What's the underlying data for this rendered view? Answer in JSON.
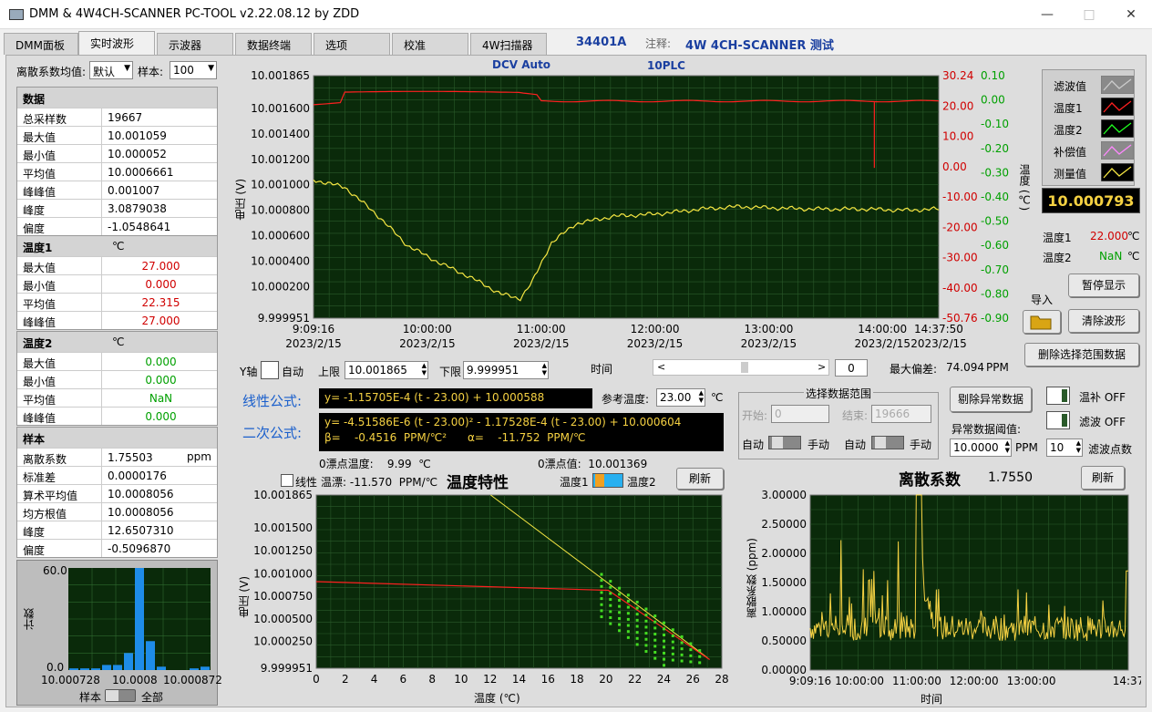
{
  "window": {
    "title": "DMM & 4W4CH-SCANNER PC-TOOL v2.22.08.12 by ZDD"
  },
  "tabs": [
    "DMM面板",
    "实时波形",
    "示波器",
    "数据终端",
    "选项",
    "校准",
    "4W扫描器"
  ],
  "header": {
    "model": "34401A",
    "note_label": "注释:",
    "note": "4W 4CH-SCANNER 测试",
    "mode": "DCV  Auto",
    "nplc": "10PLC"
  },
  "controls": {
    "avg_label": "离散系数均值:",
    "avg_value": "默认",
    "sample_label": "样本:",
    "sample_value": "100"
  },
  "stats": {
    "data": {
      "title": "数据",
      "rows": [
        [
          "总采样数",
          "19667"
        ],
        [
          "最大值",
          "10.001059"
        ],
        [
          "最小值",
          "10.000052"
        ],
        [
          "平均值",
          "10.0006661"
        ],
        [
          "峰峰值",
          "0.001007"
        ],
        [
          "峰度",
          "3.0879038"
        ],
        [
          "偏度",
          "-1.0548641"
        ]
      ]
    },
    "temp1": {
      "title": "温度1",
      "unit": "℃",
      "rows": [
        [
          "最大值",
          "27.000"
        ],
        [
          "最小值",
          "0.000"
        ],
        [
          "平均值",
          "22.315"
        ],
        [
          "峰峰值",
          "27.000"
        ]
      ]
    },
    "temp2": {
      "title": "温度2",
      "unit": "℃",
      "rows": [
        [
          "最大值",
          "0.000"
        ],
        [
          "最小值",
          "0.000"
        ],
        [
          "平均值",
          "NaN"
        ],
        [
          "峰峰值",
          "0.000"
        ]
      ]
    },
    "sample": {
      "title": "样本",
      "rows": [
        [
          "离散系数",
          "1.75503",
          "ppm"
        ],
        [
          "标准差",
          "0.0000176",
          ""
        ],
        [
          "算术平均值",
          "10.0008056",
          ""
        ],
        [
          "均方根值",
          "10.0008056",
          ""
        ],
        [
          "峰度",
          "12.6507310",
          ""
        ],
        [
          "偏度",
          "-0.5096870",
          ""
        ]
      ]
    }
  },
  "histogram": {
    "ylabel": "计数",
    "ymax": "60.0",
    "ymin": "0.0",
    "x_labels": [
      "10.000728",
      "10.0008",
      "10.000872"
    ],
    "bars": [
      1,
      1,
      1,
      3,
      3,
      10,
      60,
      17,
      2,
      0,
      0,
      1,
      2
    ],
    "switch_left": "样本",
    "switch_right": "全部"
  },
  "main_chart": {
    "ylabel": "电压 (V)",
    "y_ticks": [
      "10.001865",
      "10.001600",
      "10.001400",
      "10.001200",
      "10.001000",
      "10.000800",
      "10.000600",
      "10.000400",
      "10.000200",
      "9.999951"
    ],
    "temp_ticks": [
      "30.24",
      "20.00",
      "10.00",
      "0.00",
      "-10.00",
      "-20.00",
      "-30.00",
      "-40.00",
      "-50.76"
    ],
    "green_ticks": [
      "0.10",
      "0.00",
      "-0.10",
      "-0.20",
      "-0.30",
      "-0.40",
      "-0.50",
      "-0.60",
      "-0.70",
      "-0.80",
      "-0.90"
    ],
    "right_axis_label": "温度 (℃)",
    "x_ticks": [
      [
        "9:09:16",
        "2023/2/15"
      ],
      [
        "10:00:00",
        "2023/2/15"
      ],
      [
        "11:00:00",
        "2023/2/15"
      ],
      [
        "12:00:00",
        "2023/2/15"
      ],
      [
        "13:00:00",
        "2023/2/15"
      ],
      [
        "14:00:00",
        "2023/2/15"
      ],
      [
        "14:37:50",
        "2023/2/15"
      ]
    ],
    "time_label": "时间"
  },
  "legend": [
    {
      "name": "滤波值",
      "color": "#cccccc"
    },
    {
      "name": "温度1",
      "color": "#ff2020"
    },
    {
      "name": "温度2",
      "color": "#20ff20"
    },
    {
      "name": "补偿值",
      "color": "#ff88ff"
    },
    {
      "name": "测量值",
      "color": "#f5e642"
    }
  ],
  "readout": {
    "value": "10.000793",
    "t1_label": "温度1",
    "t1": "22.000",
    "t2_label": "温度2",
    "t2": "NaN",
    "unit": "℃"
  },
  "buttons": {
    "pause": "暂停显示",
    "import": "导入",
    "clear": "清除波形",
    "delete_range": "删除选择范围数据",
    "remove_abnormal": "剔除异常数据",
    "refresh1": "刷新",
    "refresh2": "刷新"
  },
  "yaxis_ctrl": {
    "label": "Y轴",
    "auto": "自动",
    "upper_label": "上限",
    "upper": "10.001865",
    "lower_label": "下限",
    "lower": "9.999951",
    "time": "时间",
    "pos": "0",
    "maxdev_label": "最大偏差:",
    "maxdev": "74.094",
    "ppm": "PPM"
  },
  "formula": {
    "linear_label": "线性公式:",
    "linear": "y= -1.15705E-4 (t - 23.00) + 10.000588",
    "ref_label": "参考温度:",
    "ref": "23.00",
    "ref_unit": "℃",
    "quad_label": "二次公式:",
    "quad": "y= -4.51586E-6 (t - 23.00)² - 1.17528E-4 (t - 23.00) + 10.000604",
    "beta": "β=    -0.4516  PPM/℃²",
    "alpha": "α=    -11.752  PPM/℃",
    "zero_temp": "0漂点温度:    9.99  ℃",
    "zero_val": "0漂点值:  10.001369"
  },
  "range": {
    "title": "选择数据范围",
    "start_label": "开始:",
    "start": "0",
    "end_label": "结束:",
    "end": "19666",
    "auto": "自动",
    "manual": "手动"
  },
  "options": {
    "comp": "温补 OFF",
    "filter": "滤波 OFF",
    "thresh_label": "异常数据阈值:",
    "thresh": "10.0000",
    "thresh_unit": "PPM",
    "filt_pts": "10",
    "filt_label": "滤波点数"
  },
  "temp_chart": {
    "title": "温度特性",
    "linear_label": "线性",
    "drift_label": "温漂: -11.570  PPM/℃",
    "t1": "温度1",
    "t2": "温度2",
    "ylabel": "电压 (V)",
    "xlabel": "温度 (℃)",
    "y_ticks": [
      "10.001865",
      "10.001500",
      "10.001250",
      "10.001000",
      "10.000750",
      "10.000500",
      "10.000250",
      "9.999951"
    ],
    "x_ticks": [
      "0",
      "2",
      "4",
      "6",
      "8",
      "10",
      "12",
      "14",
      "16",
      "18",
      "20",
      "22",
      "24",
      "26",
      "28"
    ]
  },
  "disp_chart": {
    "title": "离散系数",
    "value": "1.7550",
    "ylabel": "离散系数 (ppm)",
    "xlabel": "时间",
    "y_ticks": [
      "3.00000",
      "2.50000",
      "2.00000",
      "1.50000",
      "1.00000",
      "0.50000",
      "0.00000"
    ],
    "x_ticks": [
      "9:09:16",
      "10:00:00",
      "11:00:00",
      "12:00:00",
      "13:00:00",
      "14:37"
    ]
  }
}
